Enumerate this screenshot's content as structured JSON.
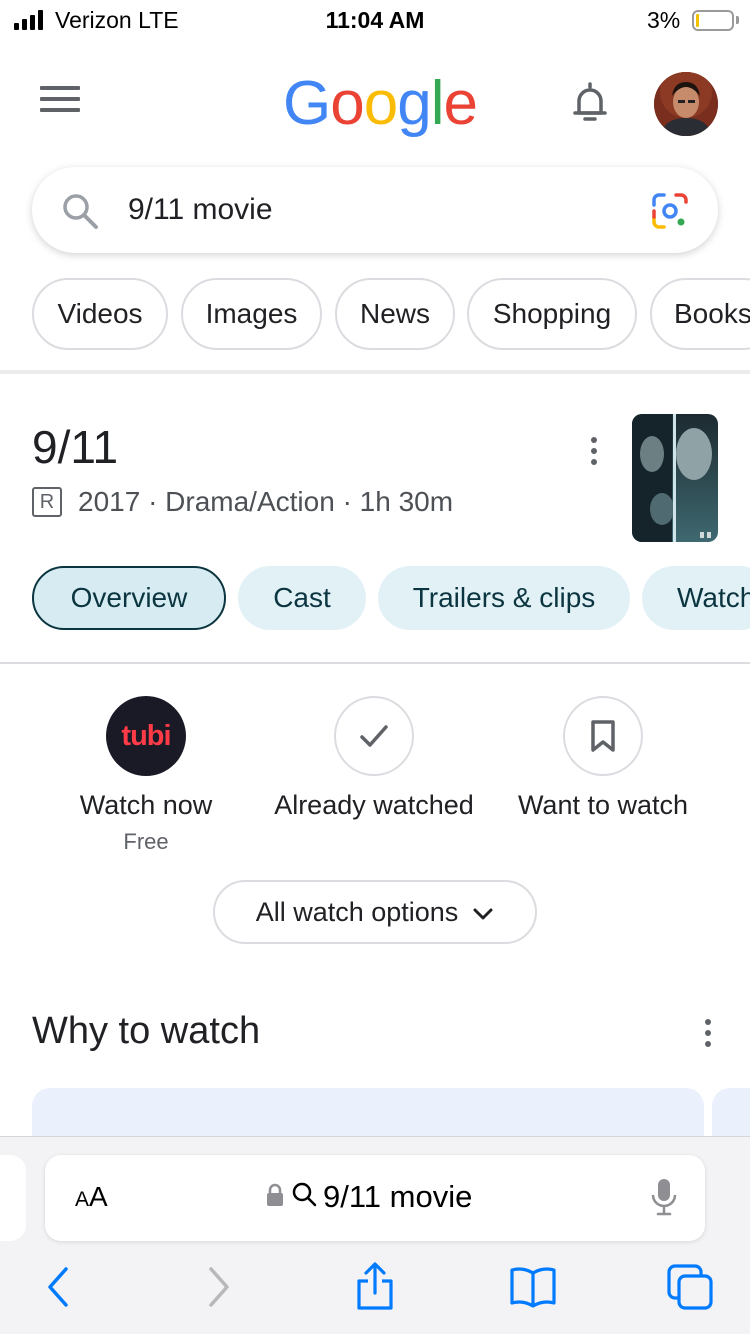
{
  "status_bar": {
    "carrier": "Verizon  LTE",
    "time": "11:04 AM",
    "battery_percent": "3%"
  },
  "header": {
    "logo_letters": [
      "G",
      "o",
      "o",
      "g",
      "l",
      "e"
    ],
    "logo_colors": [
      "#4285F4",
      "#EA4335",
      "#FBBC05",
      "#4285F4",
      "#34A853",
      "#EA4335"
    ]
  },
  "search": {
    "query": "9/11 movie"
  },
  "filter_chips": [
    "Videos",
    "Images",
    "News",
    "Shopping",
    "Books"
  ],
  "movie": {
    "title": "9/11",
    "rating": "R",
    "meta": "2017 · Drama/Action · 1h 30m",
    "tabs": [
      "Overview",
      "Cast",
      "Trailers & clips",
      "Watch"
    ],
    "active_tab": "Overview"
  },
  "watch": {
    "provider_logo_text": "tubi",
    "options": [
      {
        "label": "Watch now",
        "sub": "Free",
        "icon": "tubi-logo"
      },
      {
        "label": "Already watched",
        "sub": "",
        "icon": "checkmark-icon"
      },
      {
        "label": "Want to watch",
        "sub": "",
        "icon": "bookmark-icon"
      }
    ],
    "all_options_label": "All watch options"
  },
  "why_to_watch": {
    "heading": "Why to watch"
  },
  "browser": {
    "text_size_label_small": "A",
    "text_size_label_large": "A",
    "url_text": "9/11 movie"
  },
  "colors": {
    "accent_blue": "#007AFF",
    "tab_bg": "#E1F1F5",
    "tab_text": "#0B3540"
  }
}
